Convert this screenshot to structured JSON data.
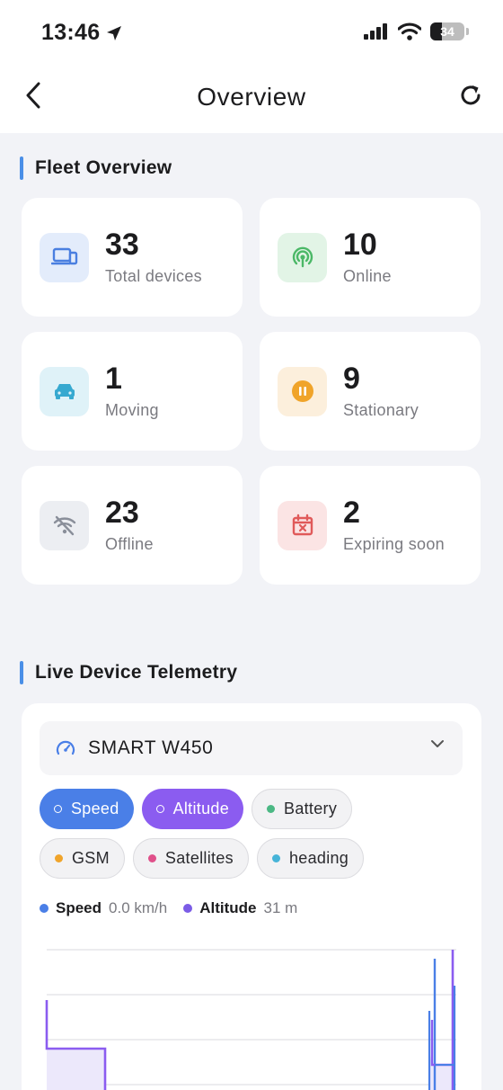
{
  "status_bar": {
    "time": "13:46",
    "battery": "34"
  },
  "nav": {
    "title": "Overview"
  },
  "fleet": {
    "title": "Fleet Overview",
    "cards": [
      {
        "value": "33",
        "label": "Total devices",
        "icon": "devices-icon",
        "icon_bg": "#e3ecfb",
        "icon_color": "#4a7fe0"
      },
      {
        "value": "10",
        "label": "Online",
        "icon": "signal-icon",
        "icon_bg": "#e2f4e6",
        "icon_color": "#4bb867"
      },
      {
        "value": "1",
        "label": "Moving",
        "icon": "car-icon",
        "icon_bg": "#dff2f8",
        "icon_color": "#36a9d0"
      },
      {
        "value": "9",
        "label": "Stationary",
        "icon": "pause-icon",
        "icon_bg": "#fcefdc",
        "icon_color": "#f0a42a"
      },
      {
        "value": "23",
        "label": "Offline",
        "icon": "wifi-off-icon",
        "icon_bg": "#eceef2",
        "icon_color": "#8a8f9a"
      },
      {
        "value": "2",
        "label": "Expiring soon",
        "icon": "calendar-x-icon",
        "icon_bg": "#fbe4e4",
        "icon_color": "#e05a5a"
      }
    ]
  },
  "telemetry": {
    "title": "Live Device Telemetry",
    "device": "SMART W450",
    "chips_row1": [
      {
        "label": "Speed",
        "active": true,
        "color": "#4a7fe7"
      },
      {
        "label": "Altitude",
        "active": true,
        "color": "#8b5cf0"
      },
      {
        "label": "Battery",
        "active": false,
        "color": "#4bb884"
      }
    ],
    "chips_row2": [
      {
        "label": "GSM",
        "active": false,
        "color": "#f0a42a"
      },
      {
        "label": "Satellites",
        "active": false,
        "color": "#e0508a"
      },
      {
        "label": "heading",
        "active": false,
        "color": "#46b4d8"
      }
    ],
    "legend": [
      {
        "name": "Speed",
        "value": "0.0 km/h",
        "color": "#4a7fe7"
      },
      {
        "name": "Altitude",
        "value": "31 m",
        "color": "#7b5ce6"
      }
    ]
  }
}
